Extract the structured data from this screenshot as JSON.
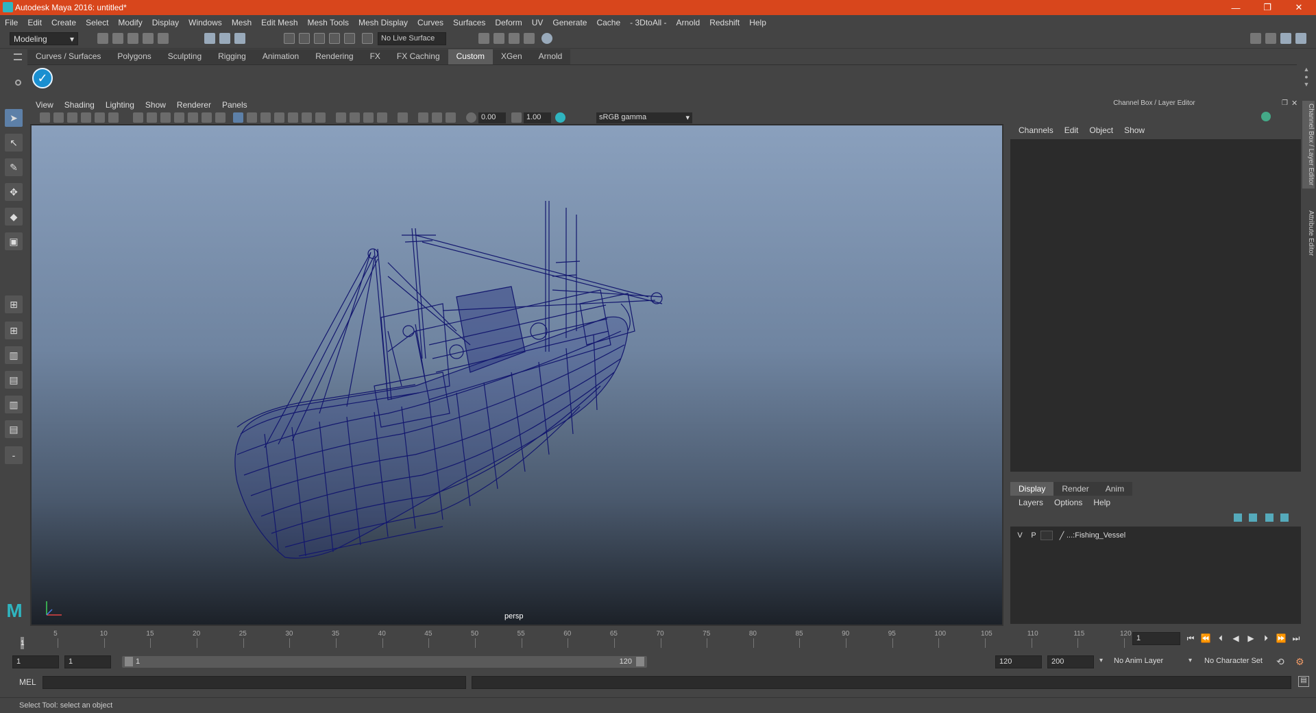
{
  "window": {
    "title": "Autodesk Maya 2016: untitled*",
    "minimize": "—",
    "restore": "❐",
    "close": "✕"
  },
  "menubar": [
    "File",
    "Edit",
    "Create",
    "Select",
    "Modify",
    "Display",
    "Windows",
    "Mesh",
    "Edit Mesh",
    "Mesh Tools",
    "Mesh Display",
    "Curves",
    "Surfaces",
    "Deform",
    "UV",
    "Generate",
    "Cache",
    "- 3DtoAll -",
    "Arnold",
    "Redshift",
    "Help"
  ],
  "statusline": {
    "mode": "Modeling",
    "live_surface": "No Live Surface"
  },
  "shelf": {
    "tabs": [
      "Curves / Surfaces",
      "Polygons",
      "Sculpting",
      "Rigging",
      "Animation",
      "Rendering",
      "FX",
      "FX Caching",
      "Custom",
      "XGen",
      "Arnold"
    ],
    "active_tab": "Custom"
  },
  "viewport": {
    "menu": [
      "View",
      "Shading",
      "Lighting",
      "Show",
      "Renderer",
      "Panels"
    ],
    "exposure": "0.00",
    "gamma": "1.00",
    "color_space": "sRGB gamma",
    "camera": "persp"
  },
  "channel_box": {
    "title": "Channel Box / Layer Editor",
    "menu": [
      "Channels",
      "Edit",
      "Object",
      "Show"
    ]
  },
  "layer_editor": {
    "tabs": [
      "Display",
      "Render",
      "Anim"
    ],
    "active_tab": "Display",
    "menu": [
      "Layers",
      "Options",
      "Help"
    ],
    "layers": [
      {
        "v": "V",
        "p": "P",
        "name": "...:Fishing_Vessel"
      }
    ]
  },
  "side_tabs": [
    "Channel Box / Layer Editor",
    "Attribute Editor"
  ],
  "timeline": {
    "ticks": [
      5,
      10,
      15,
      20,
      25,
      30,
      35,
      40,
      45,
      50,
      55,
      60,
      65,
      70,
      75,
      80,
      85,
      90,
      95,
      100,
      105,
      110,
      115,
      120
    ],
    "current_frame_label": "1",
    "current_frame": "1"
  },
  "range": {
    "start": "1",
    "playback_start": "1",
    "slider_start": "1",
    "slider_end": "120",
    "playback_end": "120",
    "end": "200",
    "anim_layer": "No Anim Layer",
    "character_set": "No Character Set"
  },
  "command_line": {
    "label": "MEL"
  },
  "help_line": "Select Tool: select an object"
}
